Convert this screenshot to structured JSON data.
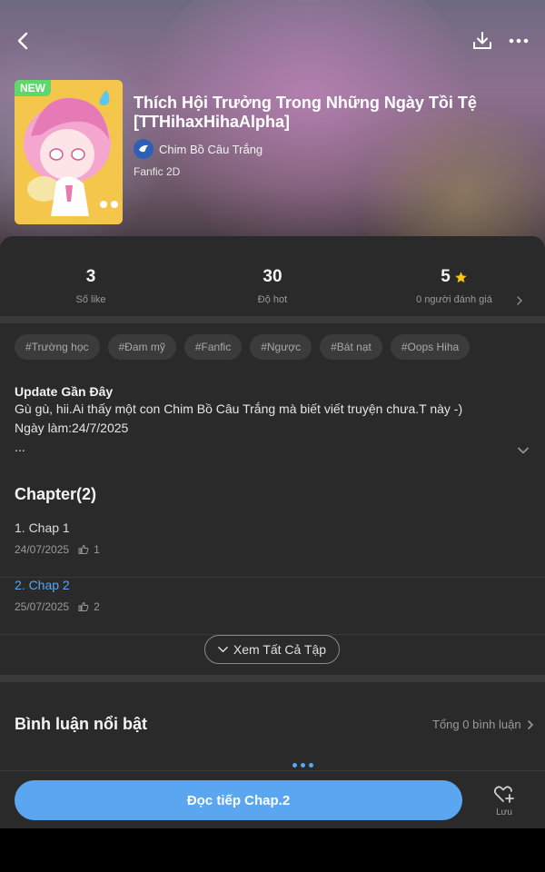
{
  "story": {
    "badge": "NEW",
    "title": "Thích Hội Trưởng Trong Những Ngày Tồi Tệ [TTHihaxHihaAlpha]",
    "author": "Chim Bồ Câu Trắng",
    "genre": "Fanfic 2D"
  },
  "stats": {
    "likes": {
      "value": "3",
      "label": "Số like"
    },
    "hot": {
      "value": "30",
      "label": "Độ hot"
    },
    "rating": {
      "value": "5",
      "label": "0 người đánh giá"
    }
  },
  "tags": [
    "#Trường học",
    "#Đam mỹ",
    "#Fanfic",
    "#Ngược",
    "#Bát nạt",
    "#Oops Hiha"
  ],
  "update": {
    "title": "Update Gần Đây",
    "lines": [
      "Gù gù, hii.Ai thấy một con Chim Bồ Câu Trắng mà biết viết truyện chưa.T này -)",
      "Ngày làm:24/7/2025",
      "..."
    ]
  },
  "chapters": {
    "heading": "Chapter(2)",
    "items": [
      {
        "name": "1. Chap 1",
        "date": "24/07/2025",
        "likes": "1"
      },
      {
        "name": "2. Chap 2",
        "date": "25/07/2025",
        "likes": "2"
      }
    ],
    "see_all_label": "Xem Tất Cả Tập"
  },
  "comments": {
    "heading": "Bình luận nổi bật",
    "total": "Tổng 0 bình luận"
  },
  "bottom": {
    "read_label": "Đọc tiếp Chap.2",
    "save_label": "Lưu"
  },
  "colors": {
    "accent": "#5aa6f0",
    "new_badge": "#5fd86a",
    "star": "#f5c518",
    "panel": "#2a2a2a"
  },
  "icons": {
    "back": "chevron-left-icon",
    "download": "download-icon",
    "more": "more-dots-icon",
    "star": "star-icon",
    "thumb": "thumb-up-icon",
    "expand": "chevron-down-icon",
    "save": "heart-plus-icon"
  }
}
